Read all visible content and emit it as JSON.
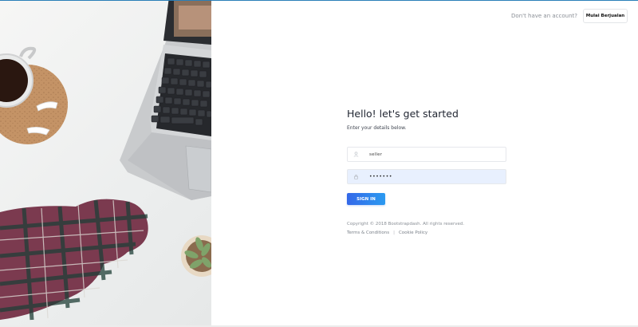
{
  "header": {
    "prompt_text": "Don't have an account?",
    "register_label": "Mulai Berjualan"
  },
  "login": {
    "title": "Hello! let's get started",
    "subtitle": "Enter your details below.",
    "username": {
      "value": "seller",
      "icon": "user-icon"
    },
    "password": {
      "value": "•••••••",
      "icon": "lock-icon"
    },
    "signin_label": "SIGN IN"
  },
  "footer": {
    "copyright": "Copyright © 2018 Bootstrapdash. All rights reserved.",
    "terms_label": "Terms & Conditions",
    "separator": "|",
    "cookie_label": "Cookie Policy"
  },
  "colors": {
    "accent_start": "#3468e8",
    "accent_end": "#2b9af0",
    "password_bg": "#e8f0fe"
  }
}
